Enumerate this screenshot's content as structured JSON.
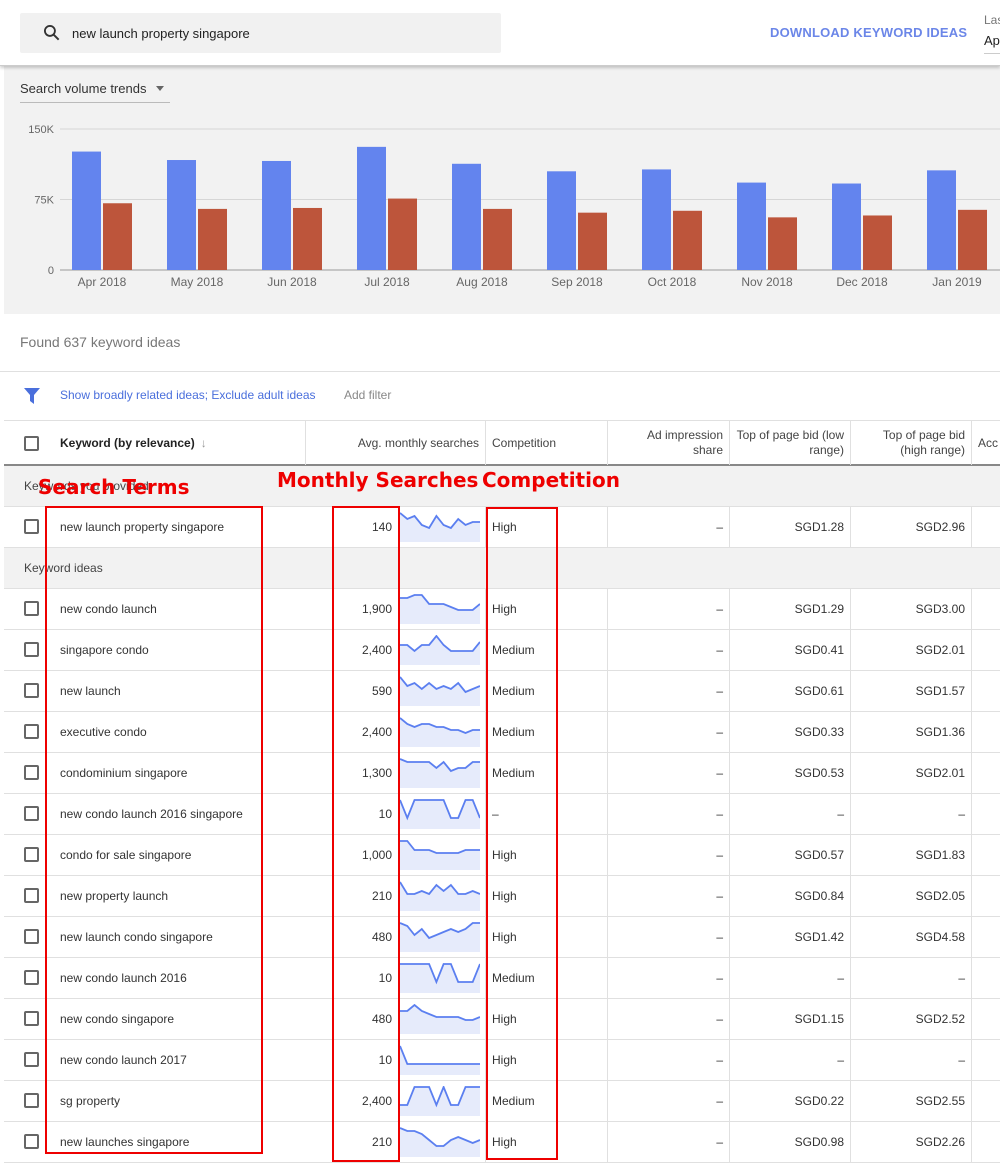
{
  "search": {
    "query": "new launch property singapore"
  },
  "header": {
    "download_label": "DOWNLOAD KEYWORD IDEAS",
    "date_label": "Las",
    "date_value": "Ap"
  },
  "chart_controls": {
    "selected": "Search volume trends"
  },
  "chart_data": {
    "type": "bar",
    "title": "Search volume trends",
    "categories": [
      "Apr 2018",
      "May 2018",
      "Jun 2018",
      "Jul 2018",
      "Aug 2018",
      "Sep 2018",
      "Oct 2018",
      "Nov 2018",
      "Dec 2018",
      "Jan 2019"
    ],
    "series": [
      {
        "name": "Total",
        "color": "#6384ee",
        "values": [
          126000,
          117000,
          116000,
          131000,
          113000,
          105000,
          107000,
          93000,
          92000,
          106000
        ]
      },
      {
        "name": "Mobile",
        "color": "#bd553b",
        "values": [
          71000,
          65000,
          66000,
          76000,
          65000,
          61000,
          63000,
          56000,
          58000,
          64000
        ]
      }
    ],
    "yticks": [
      "0",
      "75K",
      "150K"
    ],
    "ytick_values": [
      0,
      75000,
      150000
    ],
    "ylim": [
      0,
      150000
    ],
    "grid": true
  },
  "found_text": "Found 637 keyword ideas",
  "filters": {
    "link": "Show broadly related ideas; Exclude adult ideas",
    "add": "Add filter"
  },
  "columns": {
    "keyword": "Keyword (by relevance)",
    "searches": "Avg. monthly searches",
    "competition": "Competition",
    "impression": "Ad impression share",
    "low": "Top of page bid (low range)",
    "high": "Top of page bid (high range)",
    "account": "Acc"
  },
  "sections": {
    "provided": "Keywords you provided",
    "ideas": "Keyword ideas"
  },
  "provided_rows": [
    {
      "keyword": "new launch property singapore",
      "searches": "140",
      "competition": "High",
      "impression": "–",
      "low": "SGD1.28",
      "high": "SGD2.96",
      "trend": [
        9,
        7,
        8,
        5,
        4,
        8,
        5,
        4,
        7,
        5,
        6,
        6
      ]
    }
  ],
  "idea_rows": [
    {
      "keyword": "new condo launch",
      "searches": "1,900",
      "competition": "High",
      "impression": "–",
      "low": "SGD1.29",
      "high": "SGD3.00",
      "trend": [
        8,
        8,
        9,
        9,
        6,
        6,
        6,
        5,
        4,
        4,
        4,
        6
      ]
    },
    {
      "keyword": "singapore condo",
      "searches": "2,400",
      "competition": "Medium",
      "impression": "–",
      "low": "SGD0.41",
      "high": "SGD2.01",
      "trend": [
        6,
        6,
        4,
        6,
        6,
        9,
        6,
        4,
        4,
        4,
        4,
        7
      ]
    },
    {
      "keyword": "new launch",
      "searches": "590",
      "competition": "Medium",
      "impression": "–",
      "low": "SGD0.61",
      "high": "SGD1.57",
      "trend": [
        9,
        6,
        7,
        5,
        7,
        5,
        6,
        5,
        7,
        4,
        5,
        6
      ]
    },
    {
      "keyword": "executive condo",
      "searches": "2,400",
      "competition": "Medium",
      "impression": "–",
      "low": "SGD0.33",
      "high": "SGD1.36",
      "trend": [
        9,
        7,
        6,
        7,
        7,
        6,
        6,
        5,
        5,
        4,
        5,
        5
      ]
    },
    {
      "keyword": "condominium singapore",
      "searches": "1,300",
      "competition": "Medium",
      "impression": "–",
      "low": "SGD0.53",
      "high": "SGD2.01",
      "trend": [
        9,
        8,
        8,
        8,
        8,
        6,
        8,
        5,
        6,
        6,
        8,
        8
      ]
    },
    {
      "keyword": "new condo launch 2016 singapore",
      "searches": "10",
      "competition": "–",
      "impression": "–",
      "low": "–",
      "high": "–",
      "trend": [
        9,
        3,
        9,
        9,
        9,
        9,
        9,
        3,
        3,
        9,
        9,
        3
      ]
    },
    {
      "keyword": "condo for sale singapore",
      "searches": "1,000",
      "competition": "High",
      "impression": "–",
      "low": "SGD0.57",
      "high": "SGD1.83",
      "trend": [
        9,
        9,
        6,
        6,
        6,
        5,
        5,
        5,
        5,
        6,
        6,
        6
      ]
    },
    {
      "keyword": "new property launch",
      "searches": "210",
      "competition": "High",
      "impression": "–",
      "low": "SGD0.84",
      "high": "SGD2.05",
      "trend": [
        9,
        5,
        5,
        6,
        5,
        8,
        6,
        8,
        5,
        5,
        6,
        5
      ]
    },
    {
      "keyword": "new launch condo singapore",
      "searches": "480",
      "competition": "High",
      "impression": "–",
      "low": "SGD1.42",
      "high": "SGD4.58",
      "trend": [
        9,
        8,
        5,
        7,
        4,
        5,
        6,
        7,
        6,
        7,
        9,
        9
      ]
    },
    {
      "keyword": "new condo launch 2016",
      "searches": "10",
      "competition": "Medium",
      "impression": "–",
      "low": "–",
      "high": "–",
      "trend": [
        9,
        9,
        9,
        9,
        9,
        3,
        9,
        9,
        3,
        3,
        3,
        9
      ]
    },
    {
      "keyword": "new condo singapore",
      "searches": "480",
      "competition": "High",
      "impression": "–",
      "low": "SGD1.15",
      "high": "SGD2.52",
      "trend": [
        7,
        7,
        9,
        7,
        6,
        5,
        5,
        5,
        5,
        4,
        4,
        5
      ]
    },
    {
      "keyword": "new condo launch 2017",
      "searches": "10",
      "competition": "High",
      "impression": "–",
      "low": "–",
      "high": "–",
      "trend": [
        9,
        3,
        3,
        3,
        3,
        3,
        3,
        3,
        3,
        3,
        3,
        3
      ]
    },
    {
      "keyword": "sg property",
      "searches": "2,400",
      "competition": "Medium",
      "impression": "–",
      "low": "SGD0.22",
      "high": "SGD2.55",
      "trend": [
        3,
        3,
        9,
        9,
        9,
        3,
        9,
        3,
        3,
        9,
        9,
        9
      ]
    },
    {
      "keyword": "new launches singapore",
      "searches": "210",
      "competition": "High",
      "impression": "–",
      "low": "SGD0.98",
      "high": "SGD2.26",
      "trend": [
        9,
        8,
        8,
        7,
        5,
        3,
        3,
        5,
        6,
        5,
        4,
        5
      ]
    }
  ],
  "annotations": {
    "terms": "Search Terms",
    "monthly": "Monthly Searches",
    "competition": "Competition"
  }
}
